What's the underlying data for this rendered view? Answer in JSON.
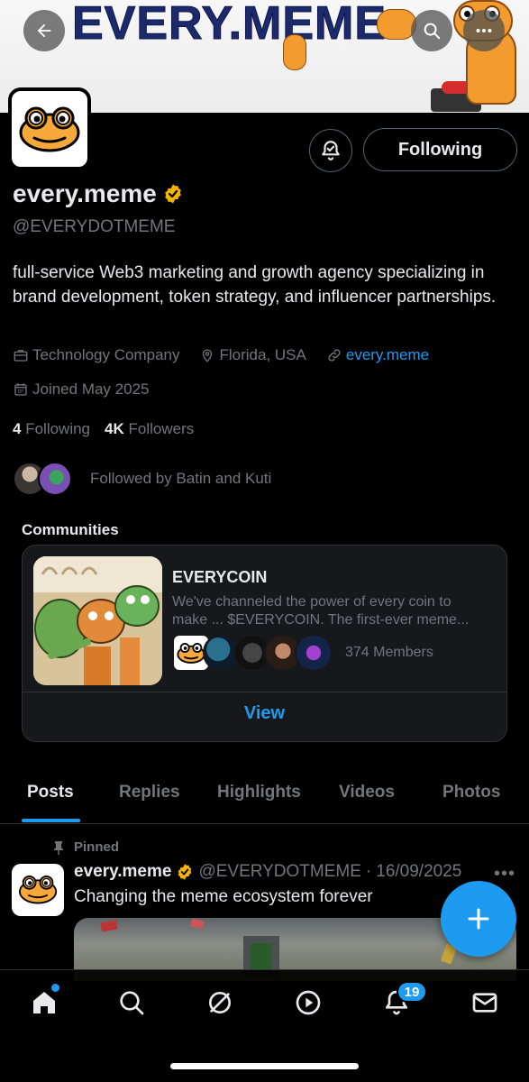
{
  "banner": {
    "text": "EVERY.MEME"
  },
  "profile": {
    "display_name": "every.meme",
    "handle": "@EVERYDOTMEME",
    "bio": "full-service Web3 marketing and growth agency specializing in brand development, token strategy, and influencer partnerships.",
    "category": "Technology Company",
    "location": "Florida, USA",
    "website": "every.meme",
    "joined": "Joined May 2025",
    "following_count": "4",
    "following_label": "Following",
    "followers_count": "4K",
    "followers_label": "Followers",
    "followed_by": "Followed by Batin and Kuti",
    "follow_button": "Following"
  },
  "communities": {
    "title": "Communities",
    "items": [
      {
        "name": "EVERYCOIN",
        "description": "We've channeled the power of every coin to make ... $EVERYCOIN. The first-ever meme...",
        "members": "374 Members",
        "action": "View"
      }
    ]
  },
  "tabs": [
    {
      "label": "Posts",
      "active": true
    },
    {
      "label": "Replies",
      "active": false
    },
    {
      "label": "Highlights",
      "active": false
    },
    {
      "label": "Videos",
      "active": false
    },
    {
      "label": "Photos",
      "active": false
    }
  ],
  "post": {
    "pinned_label": "Pinned",
    "author": "every.meme",
    "handle": "@EVERYDOTMEME",
    "separator": "·",
    "date": "16/09/2025",
    "text": "Changing the meme ecosystem forever"
  },
  "nav": {
    "notifications_badge": "19",
    "items": [
      "home-icon",
      "search-icon",
      "grok-icon",
      "play-icon",
      "bell-icon",
      "mail-icon"
    ]
  },
  "colors": {
    "accent": "#1d9bf0",
    "verified": "#f4b400",
    "background": "#000000",
    "muted": "#71767b"
  }
}
